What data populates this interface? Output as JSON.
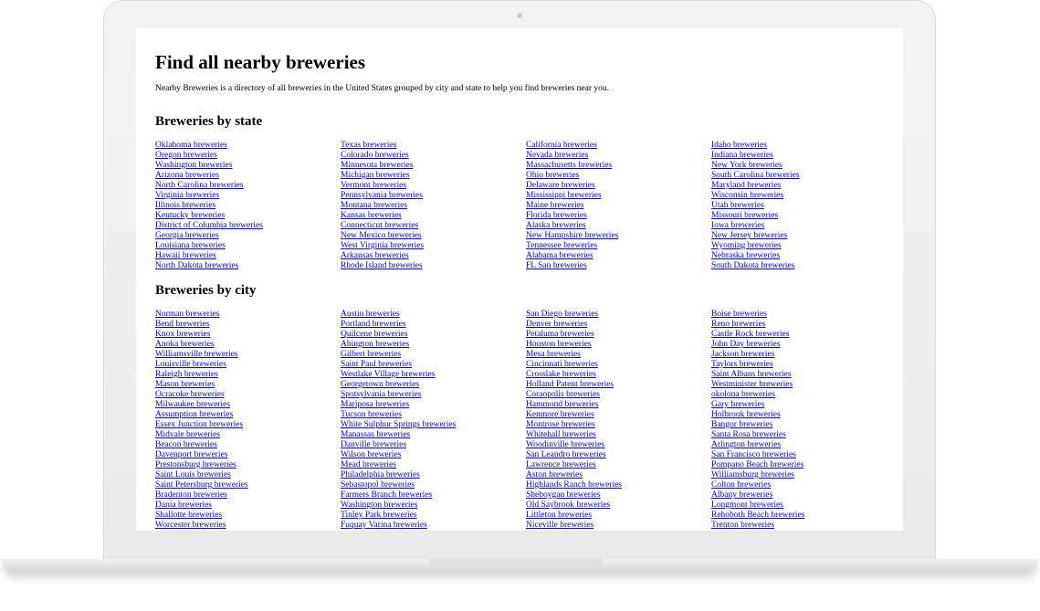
{
  "page": {
    "title": "Find all nearby breweries",
    "intro": "Nearby Breweries is a directory of all breweries in the United States grouped by city and state to help you find breweries near you."
  },
  "states": {
    "heading": "Breweries by state",
    "columns": [
      [
        "Oklahoma breweries",
        "Oregon breweries",
        "Washington breweries",
        "Arizona breweries",
        "North Carolina breweries",
        "Virginia breweries",
        "Illinois breweries",
        "Kentucky breweries",
        "District of Columbia breweries",
        "Georgia breweries",
        "Louisiana breweries",
        "Hawaii breweries",
        "North Dakota breweries"
      ],
      [
        "Texas breweries",
        "Colorado breweries",
        "Minnesota breweries",
        "Michigan breweries",
        "Vermont breweries",
        "Pennsylvania breweries",
        "Montana breweries",
        "Kansas breweries",
        "Connecticut breweries",
        "New Mexico breweries",
        "West Virginia breweries",
        "Arkansas breweries",
        "Rhode Island breweries"
      ],
      [
        "California breweries",
        "Nevada breweries",
        "Massachusetts breweries",
        "Ohio breweries",
        "Delaware breweries",
        "Mississippi breweries",
        "Maine breweries",
        "Florida breweries",
        "Alaska breweries",
        "New Hampshire breweries",
        "Tennessee breweries",
        "Alabama breweries",
        "FL San breweries"
      ],
      [
        "Idaho breweries",
        "Indiana breweries",
        "New York breweries",
        "South Carolina breweries",
        "Maryland breweries",
        "Wisconsin breweries",
        "Utah breweries",
        "Missouri breweries",
        "Iowa breweries",
        "New Jersey breweries",
        "Wyoming breweries",
        "Nebraska breweries",
        "South Dakota breweries"
      ]
    ]
  },
  "cities": {
    "heading": "Breweries by city",
    "columns": [
      [
        "Norman breweries",
        "Bend breweries",
        "Knox breweries",
        "Anoka breweries",
        "Williamsville breweries",
        "Louisville breweries",
        "Raleigh breweries",
        "Mason breweries",
        "Ocracoke breweries",
        "Milwaukee breweries",
        "Assumption breweries",
        "Essex Junction breweries",
        "Midvale breweries",
        "Beacon breweries",
        "Davenport breweries",
        "Prestonsburg breweries",
        "Saint Louis breweries",
        "Saint Petersburg breweries",
        "Bradenton breweries",
        "Dania breweries",
        "Shallotte breweries",
        "Worcester breweries"
      ],
      [
        "Austin breweries",
        "Portland breweries",
        "Quilcene breweries",
        "Abington breweries",
        "Gilbert breweries",
        "Saint Paul breweries",
        "Westlake Village breweries",
        "Georgetown breweries",
        "Spotsylvania breweries",
        "Mariposa breweries",
        "Tucson breweries",
        "White Sulphur Springs breweries",
        "Manassas breweries",
        "Danville breweries",
        "Wilson breweries",
        "Mead breweries",
        "Philadelphia breweries",
        "Sebastopol breweries",
        "Farmers Branch breweries",
        "Washington breweries",
        "Tinley Park breweries",
        "Fuquay Varina breweries"
      ],
      [
        "San Diego breweries",
        "Denver breweries",
        "Petaluma breweries",
        "Houston breweries",
        "Mesa breweries",
        "Cincinnati breweries",
        "Crosslake breweries",
        "Holland Patent breweries",
        "Coraopolis breweries",
        "Hammond breweries",
        "Kenmore breweries",
        "Montrose breweries",
        "Whitehall breweries",
        "Woodinville breweries",
        "San Leandro breweries",
        "Lawrence breweries",
        "Aston breweries",
        "Highlands Ranch breweries",
        "Sheboygan breweries",
        "Old Saybrook breweries",
        "Littleton breweries",
        "Niceville breweries"
      ],
      [
        "Boise breweries",
        "Reno breweries",
        "Castle Rock breweries",
        "John Day breweries",
        "Jackson breweries",
        "Taylors breweries",
        "Saint Albans breweries",
        "Westminister breweries",
        "okolona breweries",
        "Gary breweries",
        "Holbrook breweries",
        "Bangor breweries",
        "Santa Rosa breweries",
        "Arlington breweries",
        "San Francisco breweries",
        "Pompano Beach breweries",
        "Williamsburg breweries",
        "Colton breweries",
        "Albany breweries",
        "Longmont breweries",
        "Rehoboth Beach breweries",
        "Trenton breweries"
      ]
    ]
  }
}
